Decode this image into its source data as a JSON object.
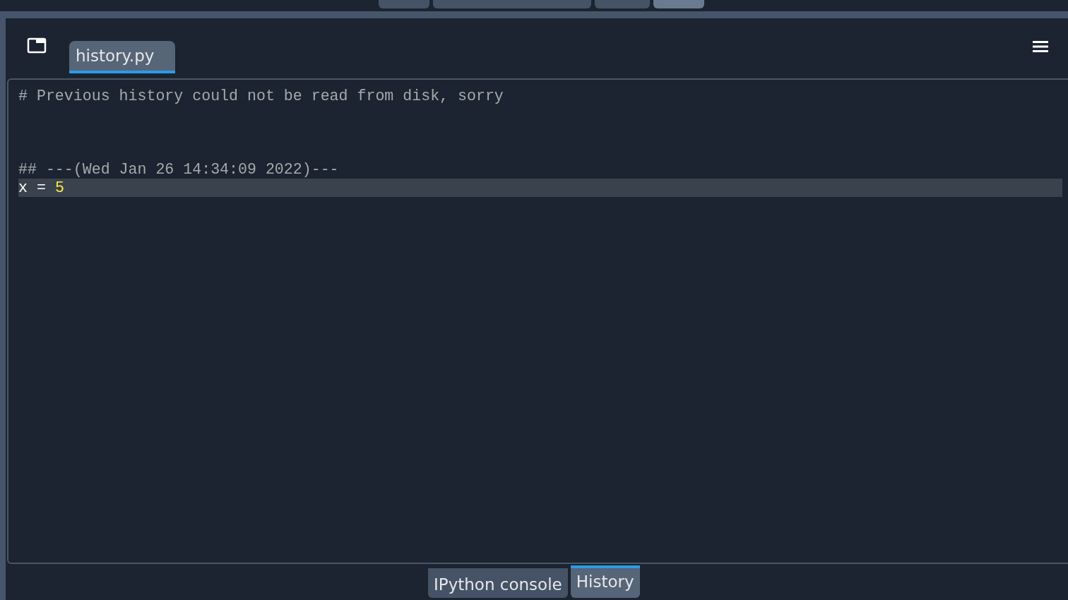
{
  "top_tabs": [
    {
      "selected": false
    },
    {
      "selected": false
    },
    {
      "selected": false
    },
    {
      "selected": true
    }
  ],
  "editor_tabs": [
    {
      "label": "history.py",
      "selected": true
    }
  ],
  "editor_lines": [
    {
      "kind": "comment",
      "text": "# Previous history could not be read from disk, sorry",
      "current": false
    },
    {
      "kind": "blank",
      "current": false
    },
    {
      "kind": "blank",
      "current": false
    },
    {
      "kind": "blank",
      "current": false
    },
    {
      "kind": "comment",
      "text": "## ---(Wed Jan 26 14:34:09 2022)---",
      "current": false
    },
    {
      "kind": "code",
      "tokens": [
        {
          "kind": "name",
          "text": "x"
        },
        {
          "kind": "op",
          "text": "="
        },
        {
          "kind": "number",
          "text": "5"
        }
      ],
      "current": true
    }
  ],
  "bottom_tabs": [
    {
      "label": "IPython console",
      "selected": false
    },
    {
      "label": "History",
      "selected": true
    }
  ]
}
